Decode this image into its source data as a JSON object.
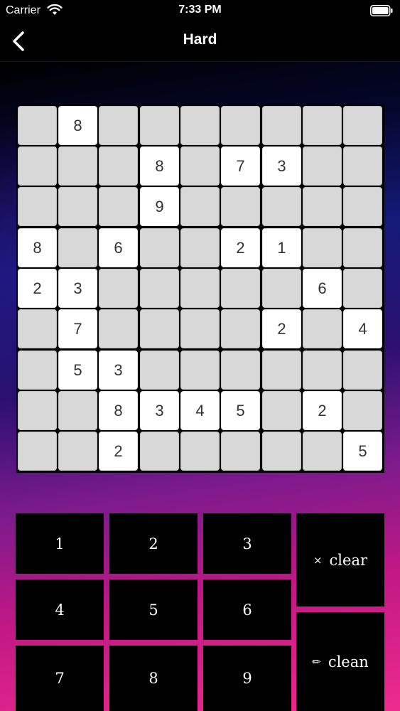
{
  "status_bar": {
    "carrier": "Carrier",
    "time": "7:33 PM"
  },
  "nav": {
    "title": "Hard",
    "back_icon": "chevron-left-icon"
  },
  "board": {
    "rows": [
      [
        "",
        "8",
        "",
        "",
        "",
        "",
        "",
        "",
        ""
      ],
      [
        "",
        "",
        "",
        "8",
        "",
        "7",
        "3",
        "",
        ""
      ],
      [
        "",
        "",
        "",
        "9",
        "",
        "",
        "",
        "",
        ""
      ],
      [
        "8",
        "",
        "6",
        "",
        "",
        "2",
        "1",
        "",
        ""
      ],
      [
        "2",
        "3",
        "",
        "",
        "",
        "",
        "",
        "6",
        ""
      ],
      [
        "",
        "7",
        "",
        "",
        "",
        "",
        "2",
        "",
        "4"
      ],
      [
        "",
        "5",
        "3",
        "",
        "",
        "",
        "",
        "",
        ""
      ],
      [
        "",
        "",
        "8",
        "3",
        "4",
        "5",
        "",
        "2",
        ""
      ],
      [
        "",
        "",
        "2",
        "",
        "",
        "",
        "",
        "",
        "5"
      ]
    ]
  },
  "keypad": {
    "digits": [
      "1",
      "2",
      "3",
      "4",
      "5",
      "6",
      "7",
      "8",
      "9"
    ],
    "clear_label": "clear",
    "clear_icon": "×",
    "clean_label": "clean",
    "clean_icon": "✏"
  }
}
